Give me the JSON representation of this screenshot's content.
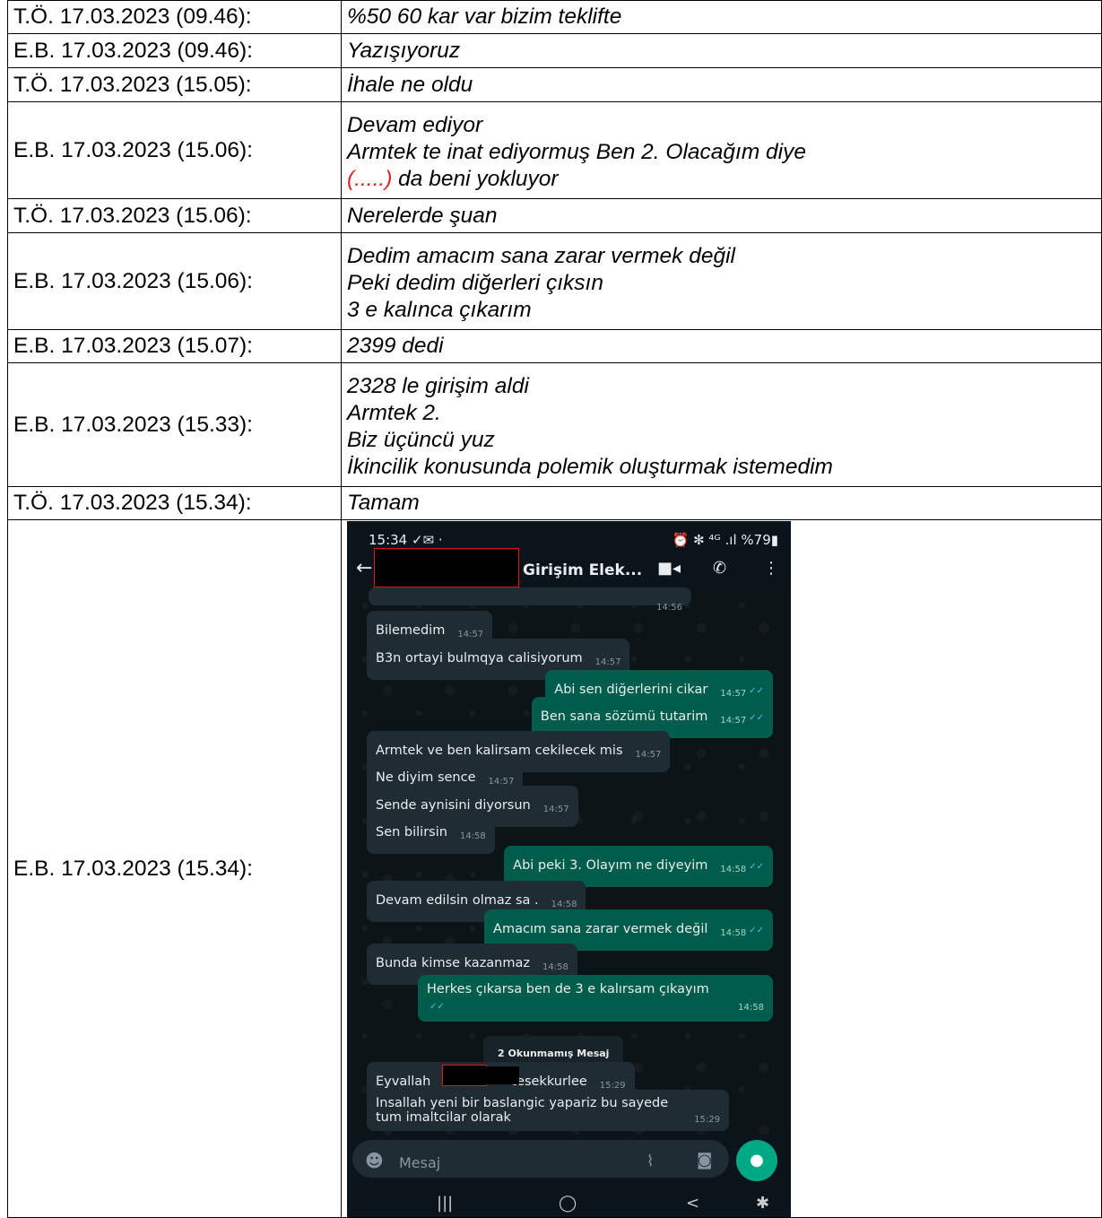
{
  "rows": [
    {
      "sender": "T.Ö. 17.03.2023 (09.46):",
      "lines": [
        "%50 60 kar var bizim teklifte"
      ]
    },
    {
      "sender": "E.B. 17.03.2023 (09.46):",
      "lines": [
        "Yazışıyoruz"
      ]
    },
    {
      "sender": "T.Ö. 17.03.2023 (15.05):",
      "lines": [
        "İhale ne oldu"
      ]
    },
    {
      "sender": "E.B. 17.03.2023 (15.06):",
      "lines": [
        "Devam ediyor",
        "Armtek te inat ediyormuş Ben 2. Olacağım diye"
      ],
      "redacted": "(.....)",
      "last_line": " da beni yokluyor"
    },
    {
      "sender": "T.Ö. 17.03.2023 (15.06):",
      "lines": [
        "Nerelerde şuan"
      ]
    },
    {
      "sender": "E.B. 17.03.2023 (15.06):",
      "lines": [
        "Dedim amacım sana zarar vermek değil",
        "Peki dedim diğerleri çıksın",
        "3 e kalınca çıkarım"
      ]
    },
    {
      "sender": "E.B. 17.03.2023 (15.07):",
      "lines": [
        "2399 dedi"
      ]
    },
    {
      "sender": "E.B. 17.03.2023 (15.33):",
      "lines": [
        "2328 le girişim aldi",
        "Armtek 2.",
        "Biz üçüncü yuz",
        "İkincilik konusunda polemik oluşturmak istemedim"
      ]
    },
    {
      "sender": "T.Ö. 17.03.2023 (15.34):",
      "lines": [
        "Tamam"
      ]
    },
    {
      "sender": "E.B. 17.03.2023 (15.34):"
    }
  ],
  "phone": {
    "status_time": "15:34 ✓✉ ·",
    "status_right": "⏰ ✻ ⁴ᴳ .ıl %79▮",
    "contact_title": "Girişim Elek...",
    "first_time": "14:56",
    "messages": [
      {
        "dir": "in",
        "text": "Bilemedim",
        "time": "14:57"
      },
      {
        "dir": "in",
        "text": "B3n ortayi bulmqya calisiyorum",
        "time": "14:57"
      },
      {
        "dir": "out",
        "text": "Abi sen diğerlerini cikar",
        "time": "14:57"
      },
      {
        "dir": "out",
        "text": "Ben sana sözümü tutarim",
        "time": "14:57"
      },
      {
        "dir": "in",
        "text": "Armtek ve ben kalirsam cekilecek mis",
        "time": "14:57"
      },
      {
        "dir": "in",
        "text": "Ne diyim sence",
        "time": "14:57"
      },
      {
        "dir": "in",
        "text": "Sende aynisini diyorsun",
        "time": "14:57"
      },
      {
        "dir": "in",
        "text": "Sen bilirsin",
        "time": "14:58"
      },
      {
        "dir": "out",
        "text": "Abi peki 3. Olayım ne diyeyim",
        "time": "14:58"
      },
      {
        "dir": "in",
        "text": "Devam edilsin olmaz sa .",
        "time": "14:58"
      },
      {
        "dir": "out",
        "text": "Amacım sana zarar vermek değil",
        "time": "14:58"
      },
      {
        "dir": "in",
        "text": "Bunda kimse kazanmaz",
        "time": "14:58"
      },
      {
        "dir": "out",
        "text": "Herkes çıkarsa ben de 3 e kalırsam çıkayım",
        "time": "14:58"
      }
    ],
    "unread_label": "2 Okunmamış Mesaj",
    "eyvallah_a": "Eyvallah",
    "eyvallah_b": "tesekkurlee",
    "eyvallah_time": "15:29",
    "last_line1": "Insallah yeni bir baslangic yapariz bu sayede",
    "last_line2": "tum imaltcilar olarak",
    "last_time": "15:29",
    "input_placeholder": "Mesaj",
    "nav": [
      "|||",
      "◯",
      "<",
      "✱"
    ]
  }
}
